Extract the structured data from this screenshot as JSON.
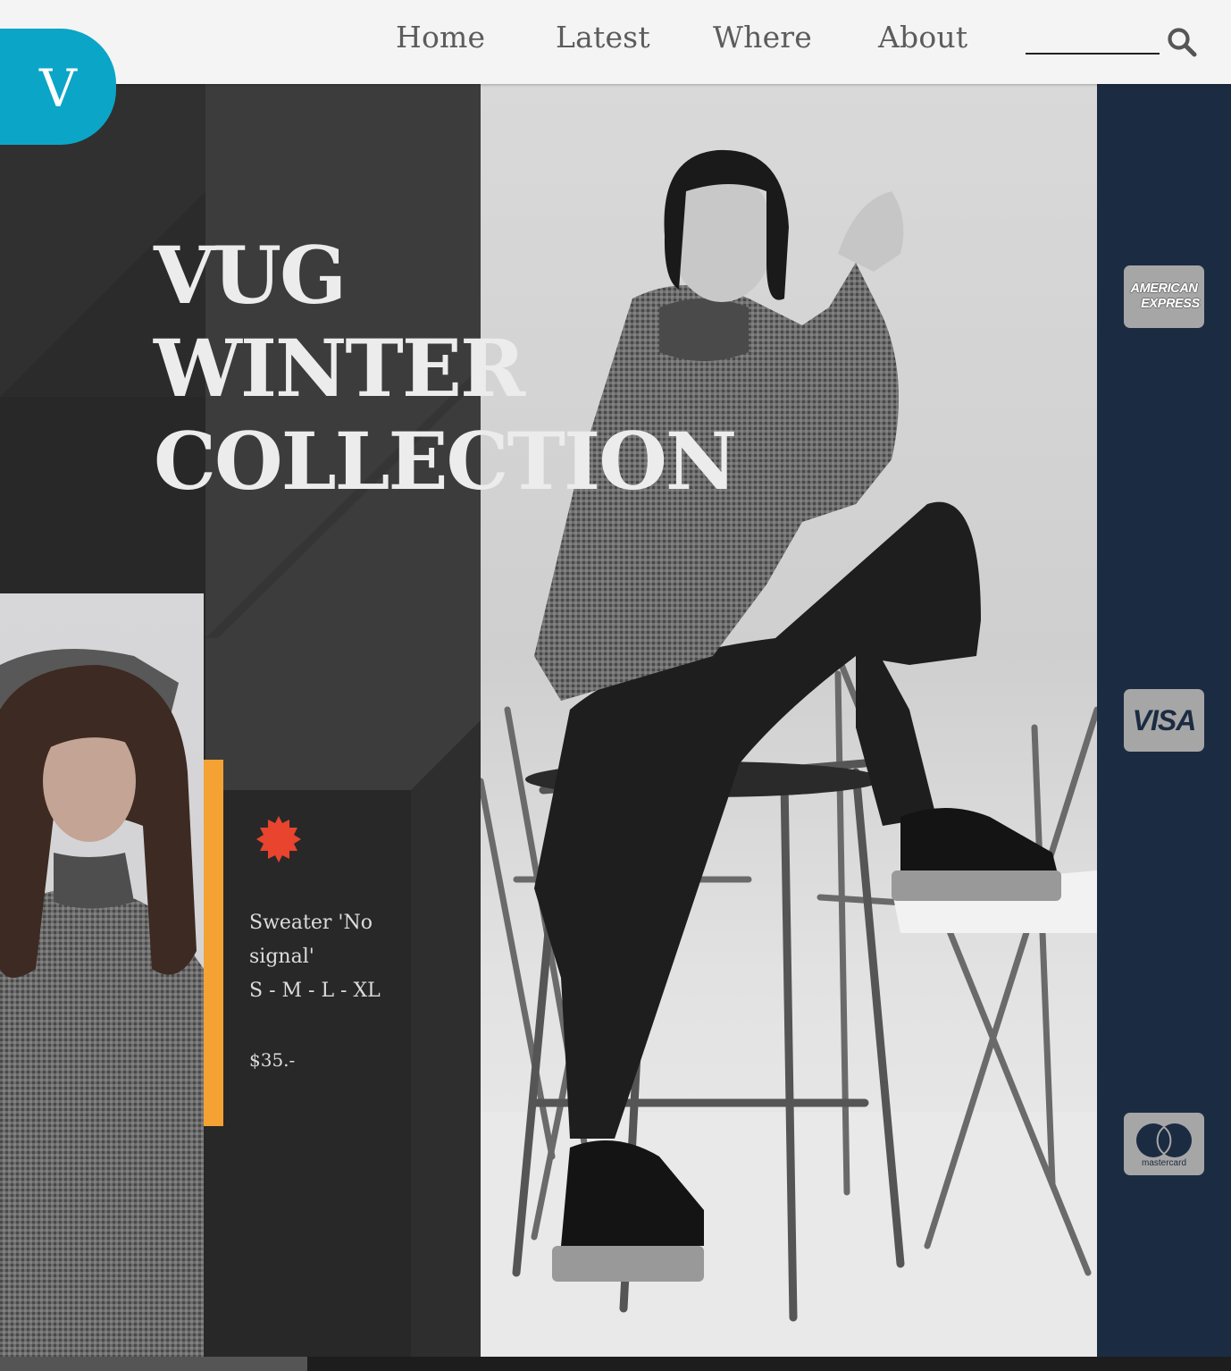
{
  "brand": {
    "logo_letter": "V",
    "accent_color": "#0ba5c7"
  },
  "nav": {
    "items": [
      {
        "label": "Home"
      },
      {
        "label": "Latest"
      },
      {
        "label": "Where"
      },
      {
        "label": "About"
      }
    ]
  },
  "search": {
    "value": "",
    "placeholder": "",
    "icon": "search-icon"
  },
  "hero": {
    "title_lines": [
      "VUG",
      "WINTER",
      "COLLECTION"
    ]
  },
  "product": {
    "badge_icon": "burst-icon",
    "badge_color": "#e8442e",
    "name": "Sweater 'No signal'",
    "sizes": "S - M - L - XL",
    "price": "$35.-",
    "accent_color": "#f4a233"
  },
  "payments": [
    {
      "icon": "amex-card-icon",
      "lines": [
        "AMERICAN",
        "EXPRESS"
      ]
    },
    {
      "icon": "visa-card-icon",
      "label": "VISA"
    },
    {
      "icon": "mastercard-card-icon",
      "label": "mastercard"
    }
  ],
  "colors": {
    "header_bg": "#f4f4f4",
    "dark_panel": "#282828",
    "navy": "#1b2c42"
  }
}
